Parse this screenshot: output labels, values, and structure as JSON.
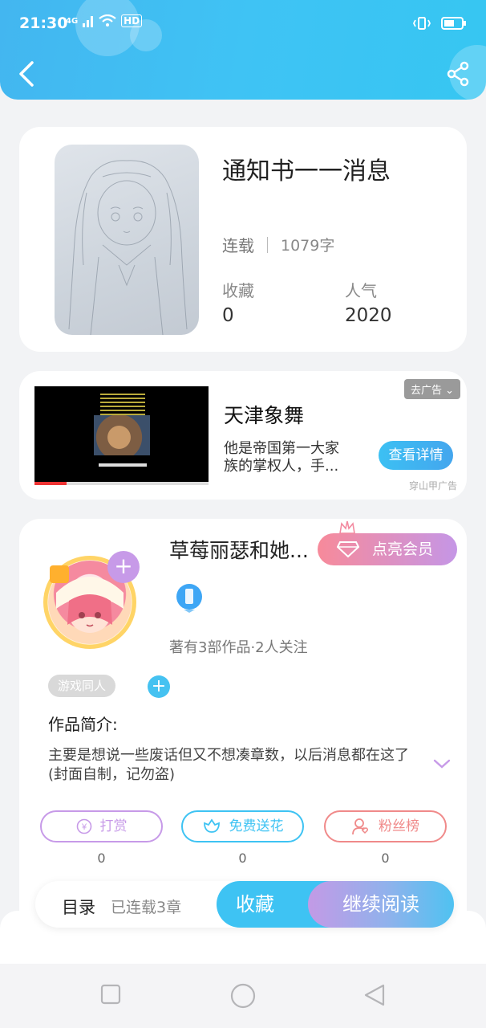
{
  "status_bar": {
    "time": "21:30",
    "network": "4G",
    "hd": "HD"
  },
  "header": {
    "back_icon": "chevron-left-icon",
    "share_icon": "share-icon"
  },
  "book": {
    "title": "通知书一一消息",
    "status": "连载",
    "word_count": "1079字",
    "favorites_label": "收藏",
    "favorites_value": "0",
    "popularity_label": "人气",
    "popularity_value": "2020"
  },
  "ad": {
    "title": "天津象舞",
    "description": "他是帝国第一大家族的掌权人，手...",
    "remove_label": "去广告",
    "detail_button": "查看详情",
    "source": "穿山甲广告"
  },
  "author": {
    "name": "草莓丽瑟和她...",
    "vip_button": "点亮会员",
    "meta": "著有3部作品·2人关注",
    "tag": "游戏同人",
    "intro_label": "作品简介:",
    "intro_text": "主要是想说一些废话但又不想凑章数，以后消息都在这了(封面自制，记勿盗)"
  },
  "actions": [
    {
      "label": "打赏",
      "count": "0",
      "color": "#c79ae8",
      "icon": "yuan-coin-icon"
    },
    {
      "label": "免费送花",
      "count": "0",
      "color": "#3ec3f3",
      "icon": "flower-icon"
    },
    {
      "label": "粉丝榜",
      "count": "0",
      "color": "#f08a8a",
      "icon": "fan-user-icon"
    }
  ],
  "bottom_bar": {
    "toc_label": "目录",
    "toc_sub": "已连载3章",
    "collect_button": "收藏",
    "read_button": "继续阅读"
  },
  "colors": {
    "accent_blue": "#3ec3f3",
    "accent_purple": "#c79ae8",
    "accent_pink": "#f78a9a"
  }
}
